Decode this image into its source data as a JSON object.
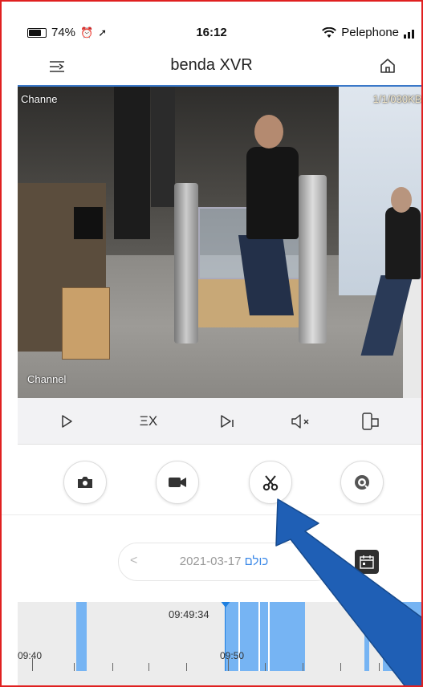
{
  "status_bar": {
    "battery": "74%",
    "time": "16:12",
    "carrier": "Pelephone"
  },
  "nav": {
    "title": "benda XVR",
    "menu_icon": "menu-list-icon",
    "home_icon": "home-icon"
  },
  "video": {
    "channel_label_top": "Channe",
    "channel_label_bottom": "Channel",
    "stats_overlay": "1/1/030KB/"
  },
  "playback_controls": [
    {
      "name": "play-icon",
      "glyph": "▷"
    },
    {
      "name": "speed-x-icon",
      "glyph": "ΞX"
    },
    {
      "name": "step-forward-icon",
      "glyph": "▷|"
    },
    {
      "name": "mute-icon",
      "glyph": "◁×"
    },
    {
      "name": "rotate-screen-icon",
      "glyph": "⊐"
    }
  ],
  "actions": [
    {
      "name": "snapshot-button",
      "icon": "camera-icon"
    },
    {
      "name": "record-button",
      "icon": "video-camera-icon"
    },
    {
      "name": "clip-button",
      "icon": "scissors-icon"
    },
    {
      "name": "playback-mode-button",
      "icon": "target-icon"
    }
  ],
  "date_selector": {
    "prev": "<",
    "next": ">",
    "filter_label": "כולם",
    "date": "2021-03-17"
  },
  "timeline": {
    "cursor_time": "09:49:34",
    "tick_labels": [
      "09:40",
      "09:50"
    ]
  },
  "colors": {
    "accent": "#3a88e8",
    "timeline_segment": "#76b4f3",
    "annotation_arrow": "#1f5fb5",
    "frame_border": "#e02020"
  }
}
